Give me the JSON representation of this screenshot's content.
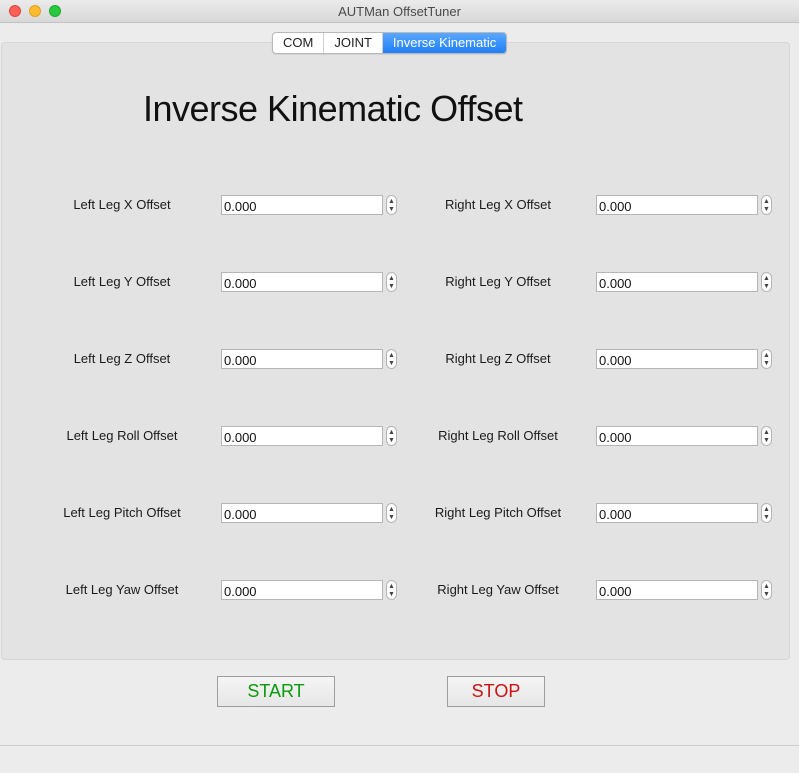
{
  "window": {
    "title": "AUTMan OffsetTuner"
  },
  "tabs": [
    {
      "label": "COM",
      "active": false
    },
    {
      "label": "JOINT",
      "active": false
    },
    {
      "label": "Inverse Kinematic",
      "active": true
    }
  ],
  "heading": "Inverse Kinematic Offset",
  "left_fields": [
    {
      "label": "Left Leg X Offset",
      "value": "0.000"
    },
    {
      "label": "Left Leg Y Offset",
      "value": "0.000"
    },
    {
      "label": "Left Leg Z Offset",
      "value": "0.000"
    },
    {
      "label": "Left Leg Roll Offset",
      "value": "0.000"
    },
    {
      "label": "Left Leg Pitch Offset",
      "value": "0.000"
    },
    {
      "label": "Left Leg Yaw Offset",
      "value": "0.000"
    }
  ],
  "right_fields": [
    {
      "label": "Right Leg X Offset",
      "value": "0.000"
    },
    {
      "label": "Right Leg Y Offset",
      "value": "0.000"
    },
    {
      "label": "Right Leg Z Offset",
      "value": "0.000"
    },
    {
      "label": "Right Leg Roll Offset",
      "value": "0.000"
    },
    {
      "label": "Right Leg Pitch Offset",
      "value": "0.000"
    },
    {
      "label": "Right Leg Yaw Offset",
      "value": "0.000"
    }
  ],
  "buttons": {
    "start_label": "START",
    "stop_label": "STOP"
  },
  "colors": {
    "start_text": "#0b9a0b",
    "stop_text": "#cc1111",
    "active_tab": "#1e7ff5"
  }
}
